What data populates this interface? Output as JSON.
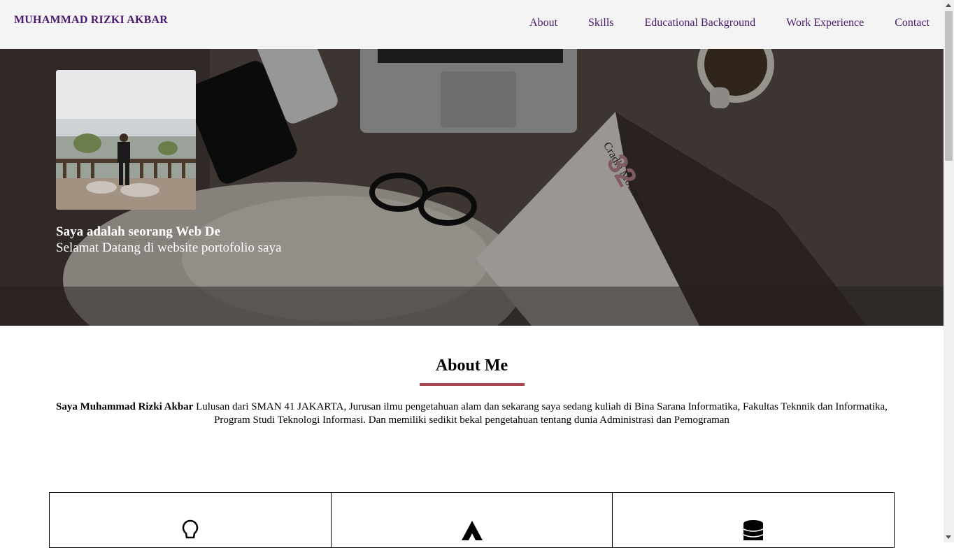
{
  "navbar": {
    "brand": "MUHAMMAD RIZKI AKBAR",
    "links": [
      {
        "label": "About"
      },
      {
        "label": "Skills"
      },
      {
        "label": "Educational Background"
      },
      {
        "label": "Work Experience"
      },
      {
        "label": "Contact"
      }
    ]
  },
  "hero": {
    "title": "Saya adalah seorang Web De",
    "subtitle": "Selamat Datang di website portofolio saya"
  },
  "about": {
    "heading": "About Me",
    "name_bold": "Saya Muhammad Rizki Akbar",
    "body": " Lulusan dari SMAN 41 JAKARTA, Jurusan ilmu pengetahuan alam dan sekarang saya sedang kuliah di Bina Sarana Informatika, Fakultas Teknnik dan Informatika, Program Studi Teknologi Informasi. Dan memiliki sedikit bekal pengetahuan tentang dunia Administrasi dan Pemograman"
  },
  "cards": [
    {
      "icon": "lightbulb-icon"
    },
    {
      "icon": "triangle-logo-icon"
    },
    {
      "icon": "database-icon"
    }
  ],
  "colors": {
    "brand": "#4b1a6e",
    "accent": "#a84452",
    "navbar_bg": "#f4f4f4"
  }
}
